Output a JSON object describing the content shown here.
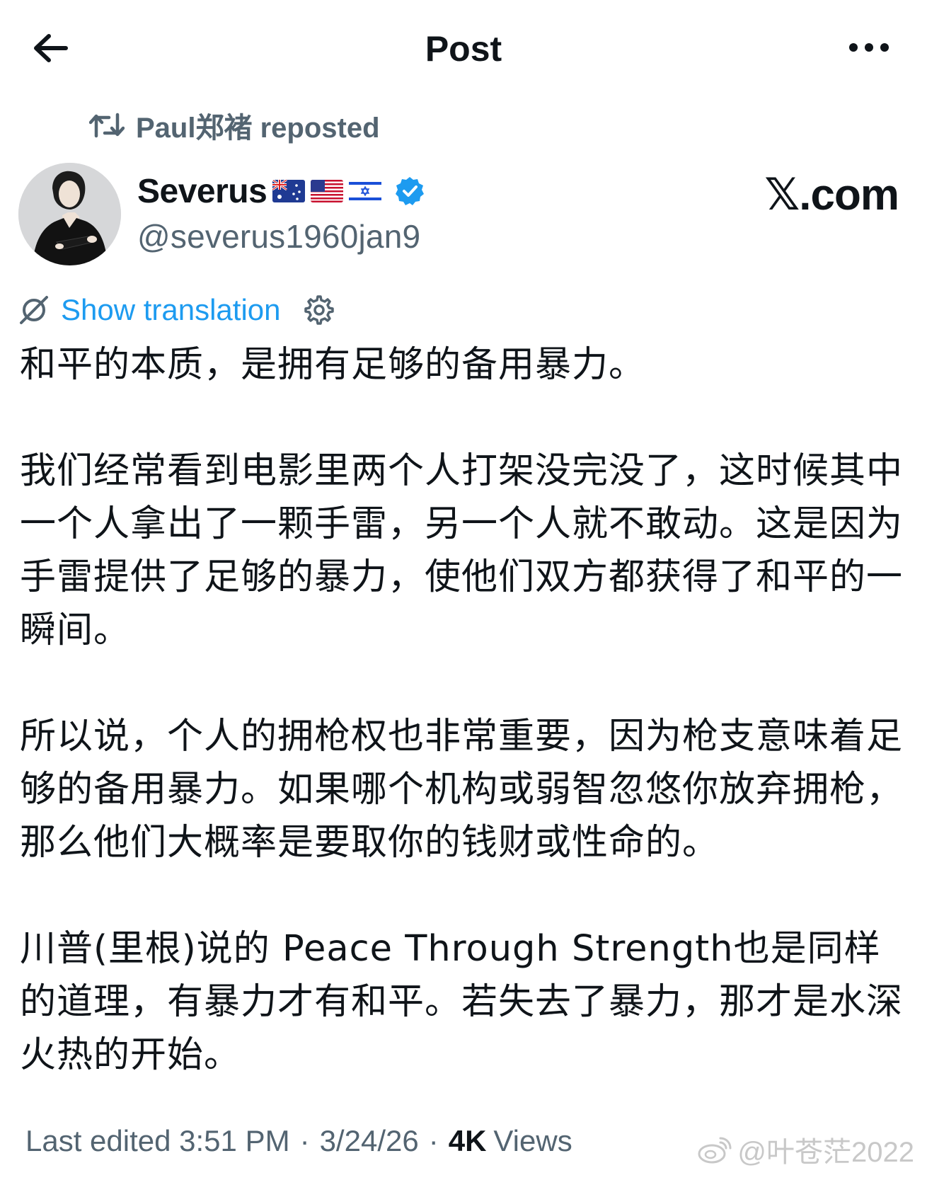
{
  "header": {
    "title": "Post",
    "back_icon": "arrow-left-icon",
    "more_icon": "more-horizontal-icon"
  },
  "repost": {
    "label": "Paul郑褚 reposted",
    "icon": "repost-icon"
  },
  "author": {
    "display_name": "Severus",
    "flags": [
      "australia-flag",
      "usa-flag",
      "israel-flag"
    ],
    "verified": true,
    "handle": "@severus1960jan9"
  },
  "watermark_site": "𝕏.com",
  "translation": {
    "link_label": "Show translation",
    "icon": "translate-icon",
    "settings_icon": "gear-icon"
  },
  "post": {
    "paragraphs": [
      "和平的本质，是拥有足够的备用暴力。",
      "我们经常看到电影里两个人打架没完没了，这时候其中一个人拿出了一颗手雷，另一个人就不敢动。这是因为手雷提供了足够的暴力，使他们双方都获得了和平的一瞬间。",
      "所以说，个人的拥枪权也非常重要，因为枪支意味着足够的备用暴力。如果哪个机构或弱智忽悠你放弃拥枪，那么他们大概率是要取你的钱财或性命的。",
      "川普(里根)说的 Peace Through Strength也是同样的道理，有暴力才有和平。若失去了暴力，那才是水深火热的开始。"
    ]
  },
  "meta": {
    "edited": "Last edited 3:51 PM",
    "separator": "·",
    "date": "3/24/26",
    "views_count": "4K",
    "views_label": "Views"
  },
  "weibo_watermark": "@叶苍茫2022",
  "colors": {
    "link": "#1d9bf0",
    "secondary_text": "#536471",
    "primary_text": "#0f1419",
    "verified_badge": "#1d9bf0"
  }
}
